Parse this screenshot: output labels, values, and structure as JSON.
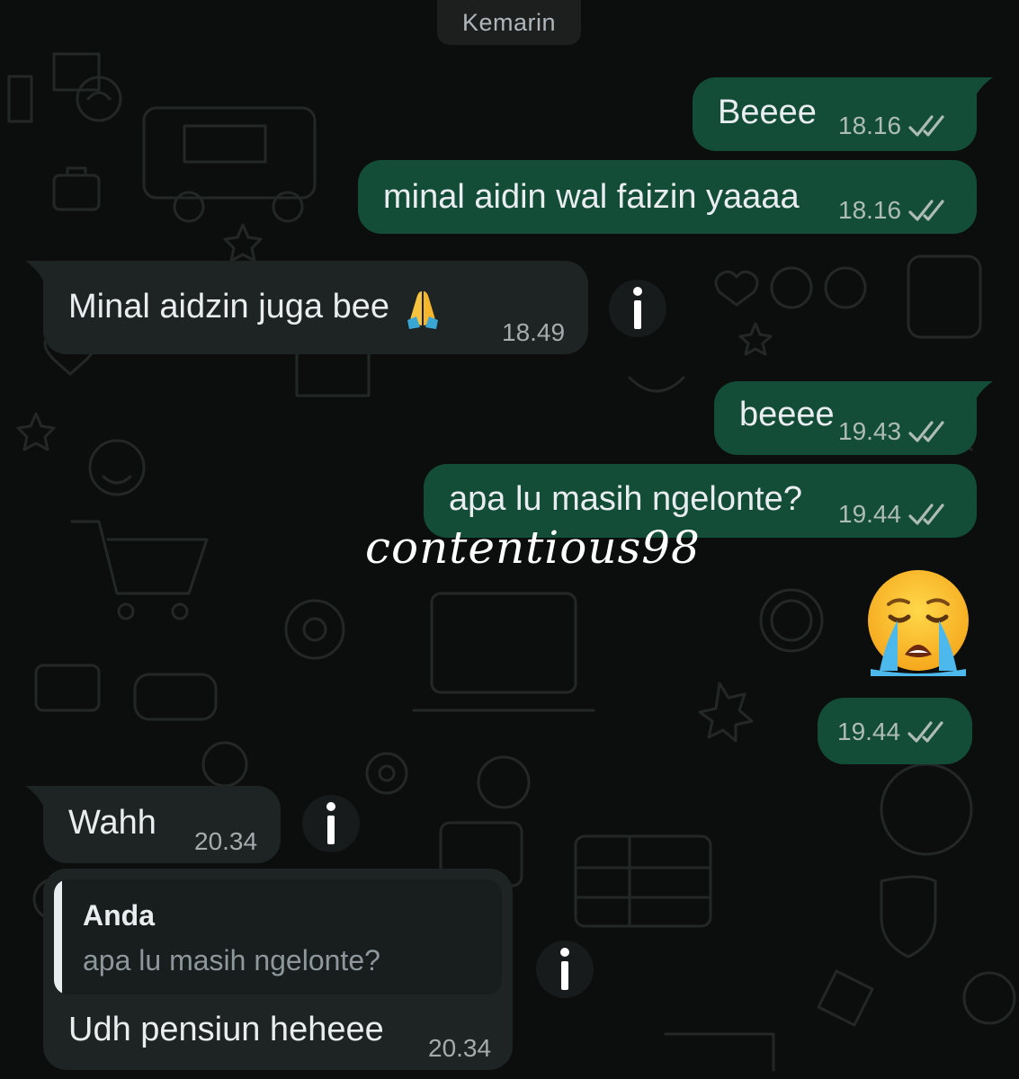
{
  "date_divider": "Kemarin",
  "watermark": "contentious98",
  "messages": [
    {
      "text": "Beeee",
      "time": "18.16"
    },
    {
      "text": "minal aidin wal faizin yaaaa",
      "time": "18.16"
    },
    {
      "text": "Minal aidzin juga bee",
      "emoji": "folded-hands",
      "time": "18.49"
    },
    {
      "text": "beeee",
      "time": "19.43"
    },
    {
      "text": "apa lu masih ngelonte?",
      "time": "19.44"
    },
    {
      "emoji": "loudly-crying-face",
      "time": "19.44"
    },
    {
      "text": "Wahh",
      "time": "20.34"
    },
    {
      "quote_author": "Anda",
      "quote_text": "apa lu masih ngelonte?",
      "text": "Udh pensiun heheee",
      "time": "20.34"
    }
  ],
  "colors": {
    "background": "#0b0e0d",
    "outgoing_bubble": "#134d37",
    "incoming_bubble": "#1e2323",
    "text": "#e9edef",
    "meta": "#aebcb6"
  },
  "icons": [
    "double-check-icon",
    "info-icon",
    "folded-hands-emoji",
    "loudly-crying-face-emoji"
  ]
}
